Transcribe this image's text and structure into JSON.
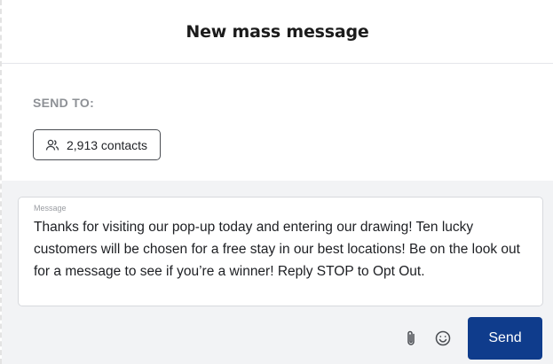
{
  "dialog": {
    "title": "New mass message"
  },
  "send_to": {
    "label": "SEND TO:",
    "recipients_chip": {
      "icon": "users-icon",
      "label": "2,913 contacts"
    }
  },
  "composer": {
    "field_label": "Message",
    "message_text": "Thanks for visiting our pop-up today and entering our drawing! Ten lucky customers will be chosen for a free stay in our best locations! Be on the look out for a message to see if you’re a winner! Reply STOP to Opt Out.",
    "attach_icon": "paperclip-icon",
    "emoji_icon": "smiley-icon",
    "send_label": "Send"
  },
  "colors": {
    "primary_button": "#0f3c8c",
    "compose_background": "#f2f3f5",
    "muted_label": "#8e9196"
  }
}
